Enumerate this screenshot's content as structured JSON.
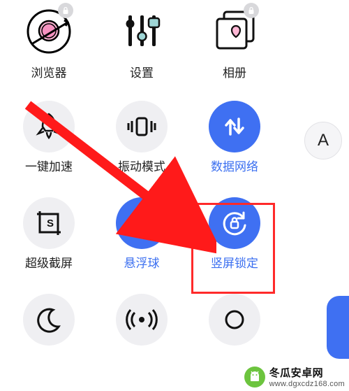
{
  "row1": {
    "browser": {
      "label": "浏览器"
    },
    "settings": {
      "label": "设置"
    },
    "gallery": {
      "label": "相册"
    }
  },
  "row2": {
    "speedup": {
      "label": "一键加速",
      "active": false
    },
    "vibrate": {
      "label": "振动模式",
      "active": false
    },
    "data": {
      "label": "数据网络",
      "active": true
    }
  },
  "row3": {
    "screenshot": {
      "label": "超级截屏",
      "active": false
    },
    "floatball": {
      "label": "悬浮球",
      "active": true
    },
    "rotlock": {
      "label": "竖屏锁定",
      "active": true
    }
  },
  "sidebar": {
    "letter": "A"
  },
  "watermark": {
    "name": "冬瓜安卓网",
    "url": "www.dgxcdz168.com"
  }
}
